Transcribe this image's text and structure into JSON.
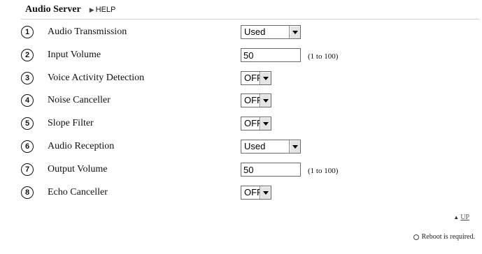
{
  "header": {
    "title": "Audio Server",
    "help_label": "HELP"
  },
  "rows": [
    {
      "num": "1",
      "label": "Audio Transmission",
      "control": "select",
      "value": "Used"
    },
    {
      "num": "2",
      "label": "Input Volume",
      "control": "input",
      "value": "50",
      "range": "(1 to 100)"
    },
    {
      "num": "3",
      "label": "Voice Activity Detection",
      "control": "select",
      "value": "OFF"
    },
    {
      "num": "4",
      "label": "Noise Canceller",
      "control": "select",
      "value": "OFF"
    },
    {
      "num": "5",
      "label": "Slope Filter",
      "control": "select",
      "value": "OFF"
    },
    {
      "num": "6",
      "label": "Audio Reception",
      "control": "select",
      "value": "Used"
    },
    {
      "num": "7",
      "label": "Output Volume",
      "control": "input",
      "value": "50",
      "range": "(1 to 100)"
    },
    {
      "num": "8",
      "label": "Echo Canceller",
      "control": "select",
      "value": "OFF"
    }
  ],
  "footer": {
    "up_label": "UP",
    "reboot_note": "Reboot is required."
  }
}
